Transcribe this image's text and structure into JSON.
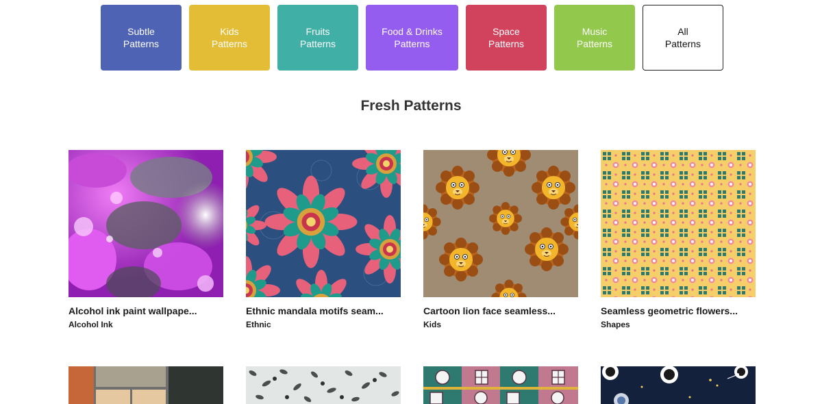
{
  "categories": [
    {
      "line1": "Subtle",
      "line2": "Patterns",
      "color": "#4e63b4"
    },
    {
      "line1": "Kids",
      "line2": "Patterns",
      "color": "#e4bd36"
    },
    {
      "line1": "Fruits",
      "line2": "Patterns",
      "color": "#40afa5"
    },
    {
      "line1": "Food & Drinks",
      "line2": "Patterns",
      "color": "#955cf0"
    },
    {
      "line1": "Space",
      "line2": "Patterns",
      "color": "#d1435c"
    },
    {
      "line1": "Music",
      "line2": "Patterns",
      "color": "#92c84b"
    },
    {
      "line1": "All",
      "line2": "Patterns",
      "color": "#ffffff"
    }
  ],
  "section_title": "Fresh Patterns",
  "patterns": [
    {
      "title": "Alcohol ink paint wallpape...",
      "category": "Alcohol Ink"
    },
    {
      "title": "Ethnic mandala motifs seam...",
      "category": "Ethnic"
    },
    {
      "title": "Cartoon lion face seamless...",
      "category": "Kids"
    },
    {
      "title": "Seamless geometric flowers...",
      "category": "Shapes"
    }
  ],
  "second_row_thumbs": [
    "abstract-blocks",
    "floral-sketch",
    "windows-tiles",
    "space-astronauts"
  ]
}
